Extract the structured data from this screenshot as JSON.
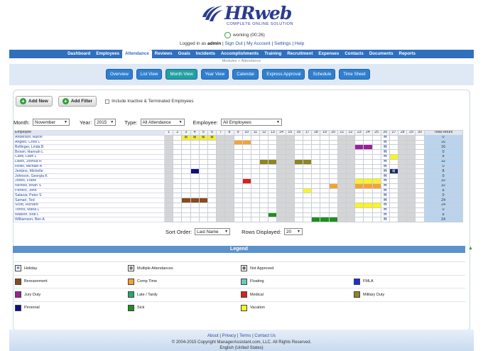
{
  "header": {
    "logo_word": "HRweb",
    "logo_tag": "COMPLETE ONLINE SOLUTION",
    "status_text": "working (00:26)",
    "logged_prefix": "Logged in as",
    "user": "admin",
    "links": [
      "Sign Out",
      "My Account",
      "Settings",
      "Help"
    ]
  },
  "nav": {
    "items": [
      "Dashboard",
      "Employees",
      "Attendance",
      "Reviews",
      "Goals",
      "Incidents",
      "Accomplishments",
      "Training",
      "Recruitment",
      "Expenses",
      "Contacts",
      "Documents",
      "Reports"
    ],
    "active": "Attendance"
  },
  "breadcrumb": "Modules > Attendance",
  "subtabs": {
    "items": [
      "Overview",
      "List View",
      "Month View",
      "Year View",
      "Calendar",
      "Express Approval",
      "Schedule",
      "Time Sheet"
    ],
    "active": "Month View"
  },
  "actions": {
    "add_new": "Add New",
    "add_filter": "Add Filter",
    "include_inactive": "Include Inactive & Terminated Employees"
  },
  "filters": {
    "month_label": "Month:",
    "month_value": "November",
    "year_label": "Year:",
    "year_value": "2015",
    "type_label": "Type:",
    "type_value": "All Attendance",
    "employee_label": "Employee:",
    "employee_value": "All Employees"
  },
  "grid": {
    "employee_header": "Employee",
    "days": [
      "1",
      "2",
      "3",
      "4",
      "5",
      "6",
      "7",
      "8",
      "9",
      "10",
      "11",
      "12",
      "13",
      "14",
      "15",
      "16",
      "17",
      "18",
      "19",
      "20",
      "21",
      "22",
      "23",
      "24",
      "25",
      "26",
      "27",
      "28",
      "29",
      "30"
    ],
    "weekend_days": [
      1,
      7,
      8,
      14,
      15,
      21,
      22,
      28,
      29
    ],
    "holiday_day": 26,
    "holiday_mark": "H",
    "total_header": "Total Hours",
    "rows": [
      {
        "name": "Anderson, Aaron",
        "total": "0",
        "marks": {
          "3": "mult",
          "4": "mult",
          "5": "mult",
          "6": "mult"
        }
      },
      {
        "name": "Angelo, Chris L",
        "total": "16",
        "marks": {
          "9": "comp",
          "10": "comp"
        }
      },
      {
        "name": "Bollinger, Linda B",
        "total": "16",
        "marks": {
          "23": "jury",
          "24": "jury"
        }
      },
      {
        "name": "Brown, Hannah L",
        "total": "0",
        "marks": {}
      },
      {
        "name": "Clark, Liam L",
        "total": "8",
        "marks": {
          "27": "vac"
        }
      },
      {
        "name": "Davis, Joshua R",
        "total": "32",
        "marks": {
          "12": "mil",
          "13": "mil",
          "16": "mil",
          "17": "mil"
        }
      },
      {
        "name": "Hollis, Michael A",
        "total": "0",
        "marks": {}
      },
      {
        "name": "Jenkins, Michelle",
        "total": "8",
        "marks": {
          "4": "pers",
          "27": "na"
        }
      },
      {
        "name": "Johnson, Georgia K",
        "total": "0",
        "marks": {}
      },
      {
        "name": "Jones, Frank",
        "total": "32",
        "marks": {
          "10": "med",
          "23": "vac",
          "24": "vac",
          "25": "vac"
        }
      },
      {
        "name": "Nichols, Brian S",
        "total": "32",
        "marks": {
          "20": "comp",
          "23": "comp",
          "24": "comp",
          "25": "comp"
        }
      },
      {
        "name": "Perfect, John",
        "total": "8",
        "marks": {
          "17": "vac"
        }
      },
      {
        "name": "Salazar, Peter S",
        "total": "0",
        "marks": {}
      },
      {
        "name": "Samari, Ted",
        "total": "24",
        "marks": {
          "3": "ber",
          "4": "ber",
          "5": "ber"
        }
      },
      {
        "name": "Scott, Richard",
        "total": "24",
        "marks": {
          "23": "vac",
          "24": "vac",
          "25": "vac"
        }
      },
      {
        "name": "Torres, Maria L",
        "total": "0",
        "marks": {}
      },
      {
        "name": "Watson, Bob L",
        "total": "8",
        "marks": {
          "13": "sick"
        }
      },
      {
        "name": "Williamson, Ben A",
        "total": "24",
        "marks": {
          "18": "sick",
          "19": "sick",
          "20": "sick"
        }
      }
    ]
  },
  "bottom": {
    "sort_label": "Sort Order:",
    "sort_value": "Last Name",
    "rows_label": "Rows Displayed:",
    "rows_value": "20"
  },
  "legend": {
    "title": "Legend",
    "items": [
      {
        "label": "Holiday",
        "type": "hol",
        "mark": "H"
      },
      {
        "label": "Multiple Attendances",
        "type": "mult",
        "mark": "⊠"
      },
      {
        "label": "Not Approved",
        "type": "na",
        "mark": "⊠"
      },
      {
        "label": "",
        "type": "blank",
        "mark": ""
      },
      {
        "label": "Bereavement",
        "type": "ber",
        "color": "#8a4a1e"
      },
      {
        "label": "Comp Time",
        "type": "comp",
        "color": "#f5a235"
      },
      {
        "label": "Floating",
        "type": "float",
        "color": "#6ec7c2"
      },
      {
        "label": "FMLA",
        "type": "fmla",
        "color": "#1a2fd6"
      },
      {
        "label": "Jury Duty",
        "type": "jury",
        "color": "#9c1f9c"
      },
      {
        "label": "Late / Tardy",
        "type": "late",
        "color": "#27a86a"
      },
      {
        "label": "Medical",
        "type": "med",
        "color": "#e31b1b"
      },
      {
        "label": "Military Duty",
        "type": "mil",
        "color": "#8d8520"
      },
      {
        "label": "Personal",
        "type": "pers",
        "color": "#0d0d80"
      },
      {
        "label": "Sick",
        "type": "sick",
        "color": "#1e8e1e"
      },
      {
        "label": "Vacation",
        "type": "vac",
        "color": "#fbf51a"
      },
      {
        "label": "",
        "type": "blank",
        "mark": ""
      }
    ]
  },
  "footer": {
    "links": [
      "About",
      "Privacy",
      "Terms",
      "Contact Us"
    ],
    "copyright": "© 2004-2015 Copyright ManagerAssistant.com, LLC. All Rights Reserved.",
    "locale": "English (United States)"
  }
}
